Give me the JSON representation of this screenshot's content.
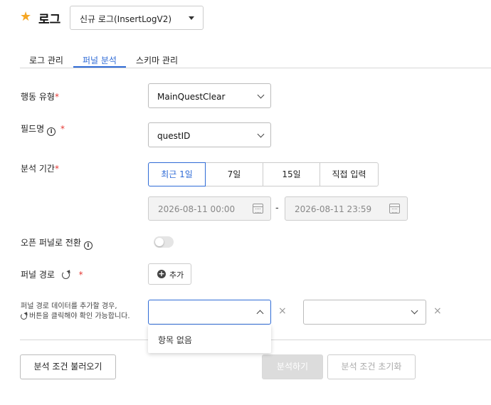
{
  "header": {
    "title": "로그",
    "log_select_value": "신규 로그(InsertLogV2)"
  },
  "tabs": [
    {
      "label": "로그 관리",
      "active": false
    },
    {
      "label": "퍼널 분석",
      "active": true
    },
    {
      "label": "스키마 관리",
      "active": false
    }
  ],
  "form": {
    "action_type": {
      "label": "행동 유형",
      "value": "MainQuestClear"
    },
    "field_name": {
      "label": "필드명",
      "value": "questID"
    },
    "period": {
      "label": "분석 기간",
      "options": [
        "최근 1일",
        "7일",
        "15일",
        "직접 입력"
      ],
      "selected": "최근 1일",
      "start": "2026-08-11 00:00",
      "end": "2026-08-11 23:59",
      "separator": "-"
    },
    "open_funnel": {
      "label": "오픈 퍼널로 전환",
      "enabled": false
    },
    "funnel_path": {
      "label": "퍼널 경로",
      "add_label": "추가",
      "hint_line1": "퍼널 경로 데이터를 추가할 경우,",
      "hint_line2": "버튼을 클릭해야 확인 가능합니다.",
      "dropdown_empty": "항목 없음",
      "remove_symbol": "×"
    },
    "required_mark": "*"
  },
  "actions": {
    "load": "분석 조건 불러오기",
    "analyze": "분석하기",
    "reset": "분석 조건 초기화"
  },
  "colors": {
    "accent": "#2f6bd6",
    "required": "#e53935",
    "star": "#f5a623"
  }
}
